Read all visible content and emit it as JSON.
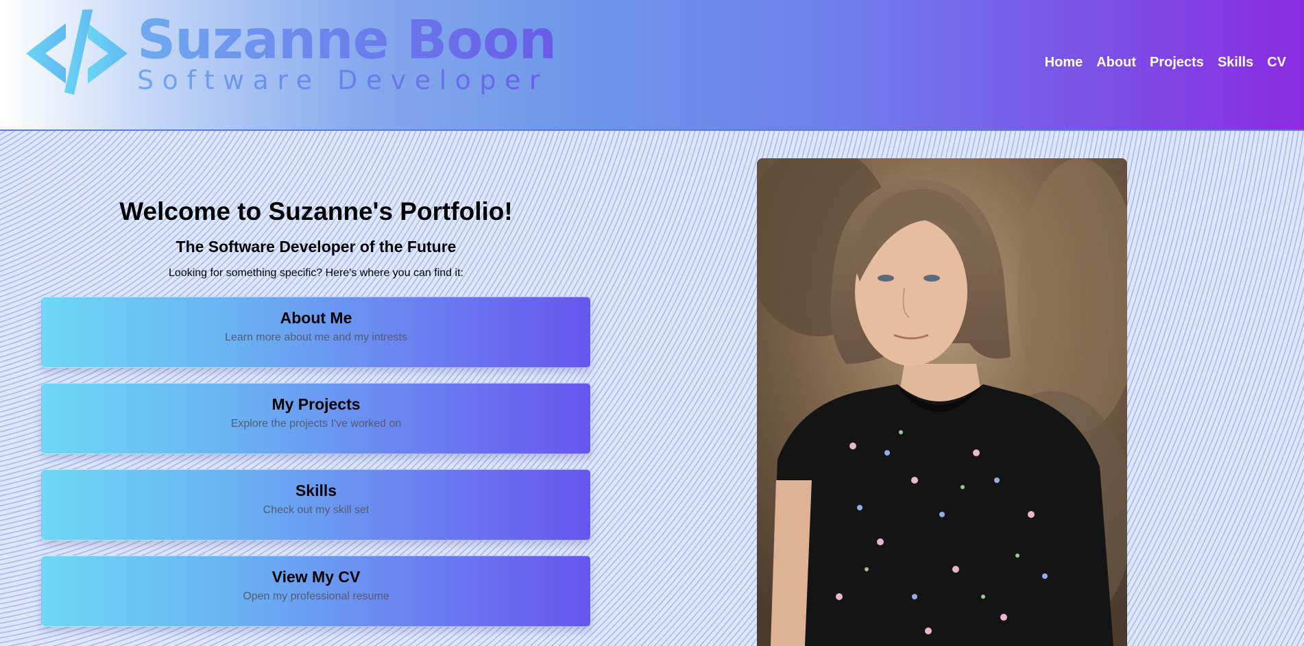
{
  "header": {
    "logo_name": "Suzanne Boon",
    "logo_subtitle": "Software Developer",
    "logo_icon": "code-brackets-icon",
    "nav": [
      {
        "label": "Home"
      },
      {
        "label": "About"
      },
      {
        "label": "Projects"
      },
      {
        "label": "Skills"
      },
      {
        "label": "CV"
      }
    ]
  },
  "intro": {
    "title": "Welcome to Suzanne's Portfolio!",
    "subtitle": "The Software Developer of the Future",
    "prompt": "Looking for something specific? Here's where you can find it:"
  },
  "cards": [
    {
      "title": "About Me",
      "description": "Learn more about me and my intrests"
    },
    {
      "title": "My Projects",
      "description": "Explore the projects I've worked on"
    },
    {
      "title": "Skills",
      "description": "Check out my skill set"
    },
    {
      "title": "View My CV",
      "description": "Open my professional resume"
    }
  ],
  "colors": {
    "header_start": "#ffffff",
    "header_end": "#8a2be2",
    "card_start": "#6ed8f5",
    "card_end": "#6656ef",
    "page_background": "#dfe8fb"
  }
}
